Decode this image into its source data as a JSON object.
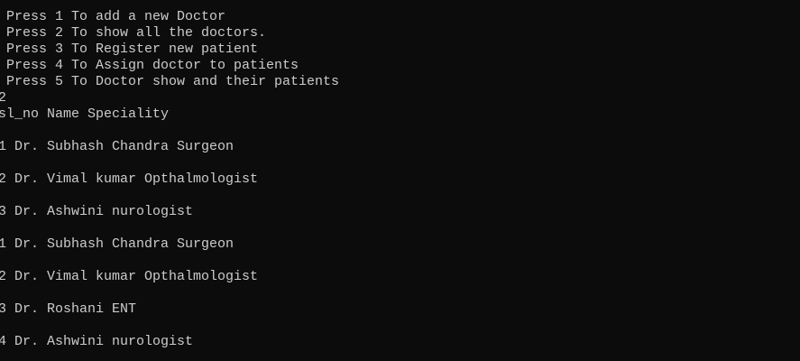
{
  "console": {
    "lines": [
      " Press 1 To add a new Doctor",
      " Press 2 To show all the doctors.",
      " Press 3 To Register new patient",
      " Press 4 To Assign doctor to patients",
      " Press 5 To Doctor show and their patients",
      "2",
      "sl_no Name Speciality",
      "1 Dr. Subhash Chandra Surgeon",
      "2 Dr. Vimal kumar Opthalmologist",
      "3 Dr. Ashwini nurologist",
      "1 Dr. Subhash Chandra Surgeon",
      "2 Dr. Vimal kumar Opthalmologist",
      "3 Dr. Roshani ENT",
      "4 Dr. Ashwini nurologist"
    ]
  }
}
